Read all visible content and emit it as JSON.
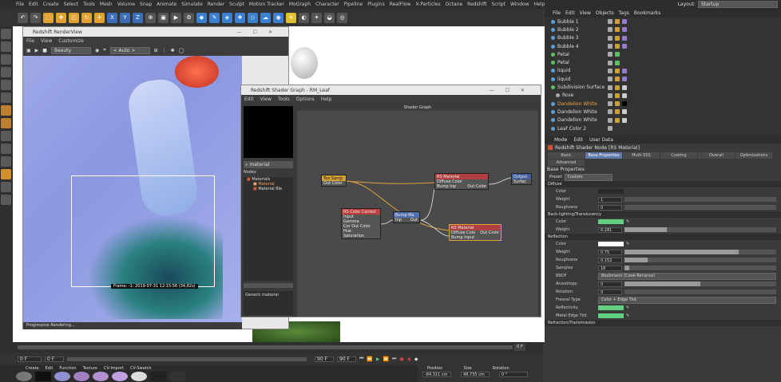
{
  "menubar": {
    "items": [
      "File",
      "Edit",
      "Create",
      "Select",
      "Tools",
      "Mesh",
      "Volume",
      "Snap",
      "Animate",
      "Simulate",
      "Render",
      "Sculpt",
      "Motion Tracker",
      "MoGraph",
      "Character",
      "Pipeline",
      "Plugins",
      "RealFlow",
      "X-Particles",
      "Octane",
      "Redshift",
      "Script",
      "Window",
      "Help"
    ],
    "layout_label": "Layout:",
    "layout_value": "Startup"
  },
  "toolbar": {
    "x": "X",
    "y": "Y",
    "z": "Z"
  },
  "render_view": {
    "title": "Redshift RenderView",
    "menu": [
      "File",
      "View",
      "Customize"
    ],
    "aov": "Beauty",
    "auto": "< Auto >",
    "frame_info": "Frame: -1:  2019-07-31  12:15:56  (34,82s)",
    "status": "Progressive Rendering..."
  },
  "shader_graph": {
    "title": "Redshift Shader Graph - RM_Leaf",
    "menu": [
      "Edit",
      "View",
      "Tools",
      "Options",
      "Help"
    ],
    "canvas_title": "Shader Graph",
    "search": "material",
    "nodes_label": "Nodes",
    "tree": {
      "root": "Materials",
      "item1": "Material",
      "item2": "Material Ble"
    },
    "info": "Generic material",
    "nodes": {
      "tex": {
        "title": "Tex Samp",
        "port": "Out Color"
      },
      "rs1": {
        "title": "RS Material",
        "port1": "Diffuse Color",
        "port2": "Bump Inp",
        "out": "Out Color"
      },
      "out": {
        "title": "Output",
        "port": "Surfac"
      },
      "cc": {
        "title": "RS Color Correct",
        "ports": [
          "Input",
          "Gamma",
          "Cor Out Color",
          "Hue",
          "Saturation"
        ]
      },
      "bump": {
        "title": "Bump Ma",
        "port1": "Inp",
        "port2": "Out"
      },
      "rs2": {
        "title": "RS Material",
        "port1": "Diffuse Colo",
        "port2": "Bump Input",
        "out": "Out Color"
      }
    }
  },
  "objects": {
    "menu": [
      "File",
      "Edit",
      "View",
      "Objects",
      "Tags",
      "Bookmarks"
    ],
    "rows": [
      "Bubble 1",
      "Bubble 2",
      "Bubble 3",
      "Bubble 4",
      "Petal",
      "Petal",
      "liquid",
      "liquid",
      "Subdivision Surface",
      "Rose",
      "Dandelion White",
      "Dandelion White",
      "Dandelion White",
      "Leaf Color 2"
    ]
  },
  "attributes": {
    "menu": [
      "Mode",
      "Edit",
      "User Data"
    ],
    "node_title": "Redshift Shader Node [RS Material]",
    "tabs": [
      "Basic",
      "Base Properties",
      "Multi-SSS",
      "Coating",
      "Overall",
      "Optimizations",
      "Advanced"
    ],
    "section": "Base Properties",
    "preset_label": "Preset",
    "preset_value": "Custom",
    "diffuse": {
      "title": "Diffuse",
      "color": "Color",
      "weight": "Weight",
      "weight_val": "1",
      "roughness": "Roughness",
      "roughness_val": "0"
    },
    "back": {
      "title": "Back-lighting/Translucency",
      "color": "Color",
      "weight": "Weight",
      "weight_val": "0.281"
    },
    "reflection": {
      "title": "Reflection",
      "color": "Color",
      "weight": "Weight",
      "weight_val": "0.75",
      "roughness": "Roughness",
      "roughness_val": "0.152",
      "samples": "Samples",
      "samples_val": "16",
      "brdf": "BRDF",
      "brdf_val": "Beckmann (Cook-Torrance)",
      "aniso": "Anisotropy",
      "aniso_val": "0",
      "rotation": "Rotation",
      "rotation_val": "0",
      "fresnel": "Fresnel Type",
      "fresnel_val": "Color + Edge Tint",
      "reflectivity": "Reflectivity",
      "edge": "Metal Edge Tint"
    },
    "refraction": "Refraction/Transmission"
  },
  "timeline": {
    "start": "0 F",
    "end": "90 F",
    "current": "0 F",
    "end2": "90 F"
  },
  "materials": {
    "menu": [
      "Create",
      "Edit",
      "Function",
      "Texture",
      "CV-Import",
      "CV-Swatch"
    ]
  },
  "coords": {
    "position": "Position",
    "size": "Size",
    "rotation": "Rotation",
    "px": "-84.311 cm",
    "sx": "48.735 cm",
    "rh": "0 °"
  }
}
